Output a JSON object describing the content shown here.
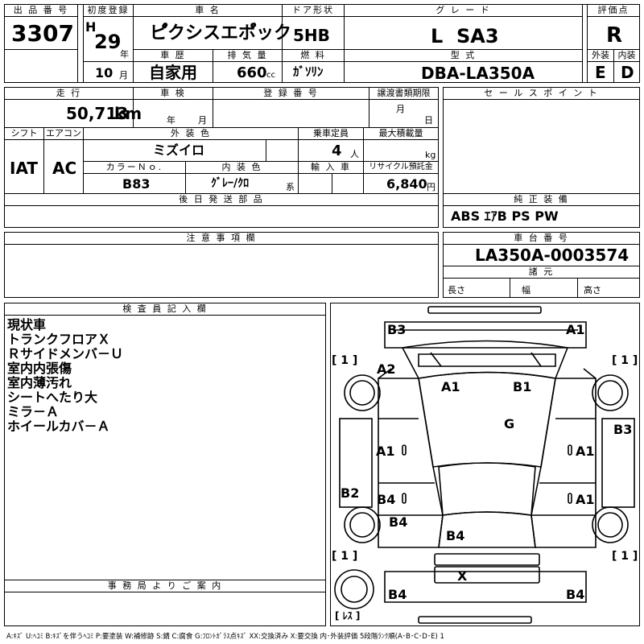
{
  "header": {
    "lot_label": "出 品 番 号",
    "lot_number": "3307",
    "first_reg_label": "初度登録",
    "era": "H",
    "year": "29",
    "year_unit": "年",
    "month": "10",
    "month_unit": "月",
    "car_name_label": "車 名",
    "car_name": "ピ゚クシスエポ゚ック",
    "door_label": "ドア形状",
    "door": "5HB",
    "grade_label": "グ レ ー ド",
    "grade": "L  SA3",
    "score_label": "評価点",
    "score": "R",
    "history_label": "車 歴",
    "history": "自家用",
    "displacement_label": "排 気 量",
    "displacement": "660",
    "displacement_unit": "cc",
    "fuel_label": "燃 料",
    "fuel": "ｶﾞｿﾘﾝ",
    "model_label": "型 式",
    "model": "DBA-LA350A",
    "exterior_label": "外装",
    "exterior": "E",
    "interior_label": "内装",
    "interior": "D"
  },
  "row2": {
    "mileage_label": "走 行",
    "mileage": "50,713",
    "mileage_unit": "km",
    "inspection_label": "車 検",
    "inspection_year_unit": "年",
    "inspection_month_unit": "月",
    "regno_label": "登 録 番 号",
    "deadline_label": "譲渡書類期限",
    "deadline_month_unit": "月",
    "deadline_day_unit": "日",
    "sales_label": "セ ー ル ス ポ イ ン ト",
    "shift_label": "シフト",
    "shift": "IAT",
    "ac_label": "エアコン",
    "ac": "AC",
    "color_label": "外 装 色",
    "color": "ミズイロ",
    "capacity_label": "乗車定員",
    "capacity": "4",
    "capacity_unit": "人",
    "load_label": "最大積載量",
    "load_unit": "kg",
    "color_no_label": "カラーＮｏ.",
    "color_no": "B83",
    "int_color_label": "内 装 色",
    "int_color": "ｸﾞﾚｰ/ｸﾛ",
    "int_color_unit": "系",
    "import_label": "輸 入 車",
    "recycle_label": "リサイクル預託金",
    "recycle": "6,840",
    "recycle_unit": "円",
    "later_parts_label": "後 日 発 送 部 品",
    "equipment_label": "純 正 装 備",
    "equipment": "ABS ｴｱB PS PW"
  },
  "notes": {
    "caution_label": "注 意 事 項 欄",
    "chassis_label": "車 台 番 号",
    "chassis": "LA350A-0003574",
    "spec_label": "諸 元",
    "length_label": "長さ",
    "width_label": "幅",
    "height_label": "高さ"
  },
  "inspector": {
    "label": "検 査 員 記 入 欄",
    "lines": [
      "現状車",
      "トランクフロアＸ",
      "Ｒサイドメンバ－Ｕ",
      "室内内張傷",
      "室内薄汚れ",
      "シートへたり大",
      "ミラ－Ａ",
      "ホイールカバ－Ａ"
    ],
    "office_label": "事 務 局 よ り ご 案 内"
  },
  "diagram": {
    "marks": [
      "B3",
      "A1",
      "A2",
      "A1",
      "B1",
      "G",
      "B3",
      "A1",
      "A1",
      "B2",
      "B4",
      "A1",
      "B4",
      "B4",
      "X",
      "B4",
      "B4"
    ],
    "tire_labels": [
      "[ 1 ]",
      "[ 1 ]",
      "[ 1 ]",
      "[ 1 ]"
    ],
    "spare_label": "[ ﾚｽ ]"
  },
  "legend": "A:ｷｽﾞ  U:ﾍｺﾐ  B:ｷｽﾞを伴うﾍｺﾐ  P:要塗装  W:補修跡  S:錆  C:腐食  G:ﾌﾛﾝﾄｶﾞﾗｽ点ｷｽﾞ  XX:交換済み  X:要交換   内･外装評価  5段階ﾗﾝｸ順(A･B･C･D･E) 1"
}
